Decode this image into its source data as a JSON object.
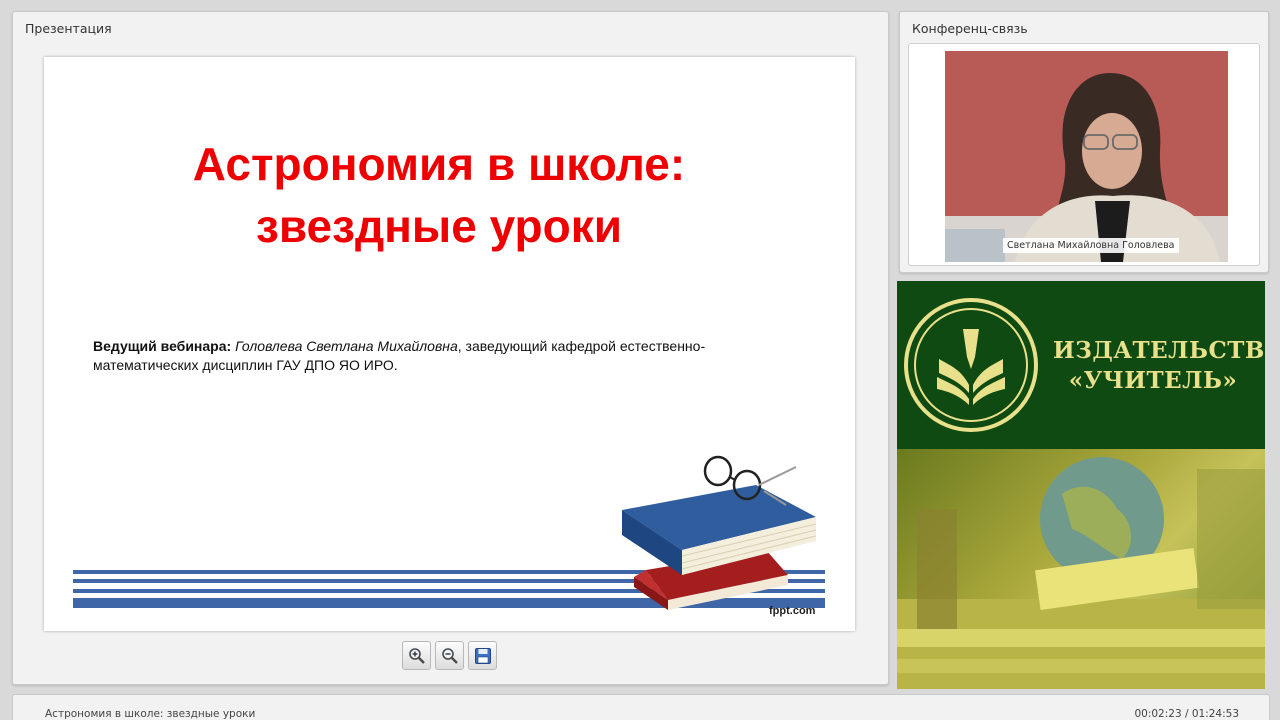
{
  "presentation": {
    "panel_title": "Презентация",
    "slide": {
      "title_line1": "Астрономия в школе:",
      "title_line2": "звездные уроки",
      "host_label": "Ведущий вебинара:",
      "host_name": "Головлева Светлана Михайловна",
      "host_desc_line1": ", заведующий кафедрой естественно-",
      "host_desc_line2": "математических дисциплин ГАУ ДПО ЯО ИРО.",
      "watermark": "fppt.com",
      "title_color": "#ee0000",
      "stripe_color": "#3f67a8"
    },
    "toolbar": {
      "zoom_in_icon": "zoom-in-icon",
      "zoom_out_icon": "zoom-out-icon",
      "save_icon": "floppy-disk-icon"
    }
  },
  "conference": {
    "panel_title": "Конференц-связь",
    "participant_name": "Светлана Михайловна Головлева"
  },
  "ad": {
    "line1": "ИЗДАТЕЛЬСТВО",
    "line2": "«УЧИТЕЛЬ»",
    "brand_color": "#0f4a12",
    "text_color": "#e8e08a"
  },
  "footer": {
    "title": "Астрономия в школе: звездные уроки",
    "time": "00:02:23 / 01:24:53"
  }
}
